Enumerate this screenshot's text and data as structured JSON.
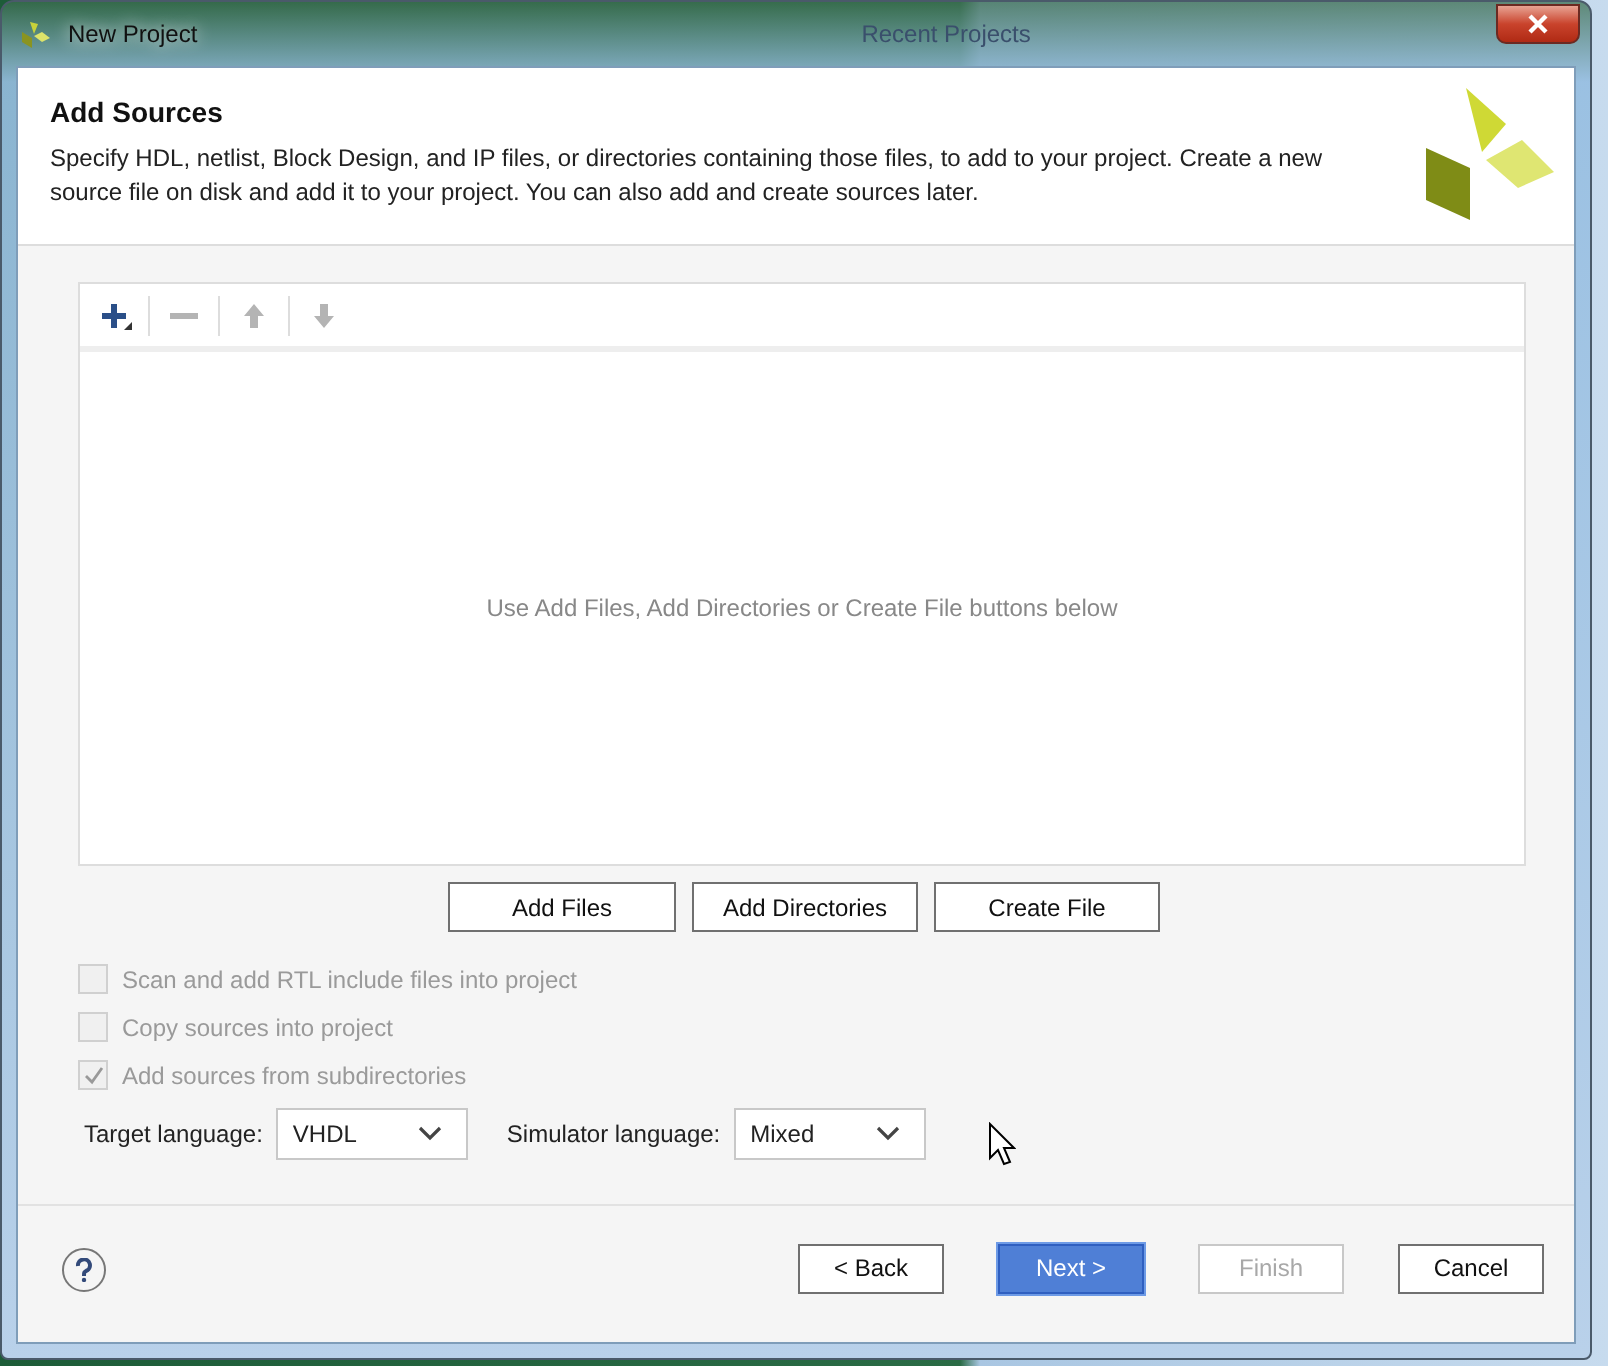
{
  "background": {
    "window_title": "Recent Projects"
  },
  "window": {
    "title": "New Project"
  },
  "header": {
    "title": "Add Sources",
    "description": "Specify HDL, netlist, Block Design, and IP files, or directories containing those files, to add to your project. Create a new source file on disk and add it to your project. You can also add and create sources later."
  },
  "toolbar": [
    {
      "kind": "add",
      "disabled": false
    },
    {
      "kind": "remove",
      "disabled": true
    },
    {
      "kind": "up",
      "disabled": true
    },
    {
      "kind": "down",
      "disabled": true
    }
  ],
  "sources_list": {
    "empty_message": "Use Add Files, Add Directories or Create File buttons below"
  },
  "source_buttons": [
    "Add Files",
    "Add Directories",
    "Create File"
  ],
  "options": [
    {
      "label": "Scan and add RTL include files into project",
      "checked": false,
      "disabled": true
    },
    {
      "label": "Copy sources into project",
      "checked": false,
      "disabled": true
    },
    {
      "label": "Add sources from subdirectories",
      "checked": true,
      "disabled": true
    }
  ],
  "languages": [
    {
      "label": "Target language:",
      "value": "VHDL"
    },
    {
      "label": "Simulator language:",
      "value": "Mixed"
    }
  ],
  "footer_buttons": [
    {
      "label": "< Back",
      "default": false,
      "disabled": false
    },
    {
      "label": "Next >",
      "default": true,
      "disabled": false
    },
    {
      "label": "Finish",
      "default": false,
      "disabled": true
    },
    {
      "label": "Cancel",
      "default": false,
      "disabled": false
    }
  ]
}
